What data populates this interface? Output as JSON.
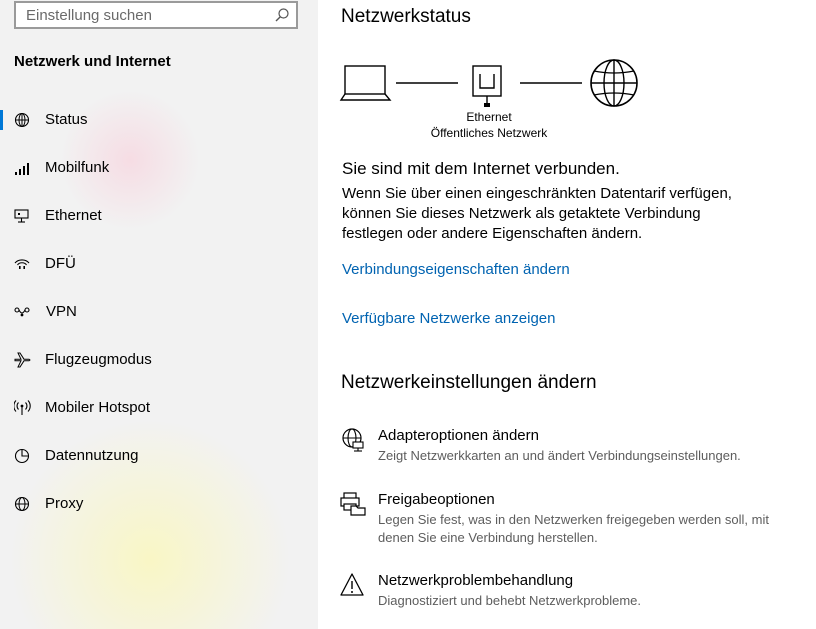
{
  "search": {
    "placeholder": "Einstellung suchen"
  },
  "sidebar": {
    "title": "Netzwerk und Internet",
    "items": [
      {
        "label": "Status",
        "icon": "globe-icon",
        "active": true
      },
      {
        "label": "Mobilfunk",
        "icon": "signal-bars-icon"
      },
      {
        "label": "Ethernet",
        "icon": "ethernet-icon"
      },
      {
        "label": "DFÜ",
        "icon": "dialup-icon"
      },
      {
        "label": "VPN",
        "icon": "vpn-icon"
      },
      {
        "label": "Flugzeugmodus",
        "icon": "airplane-icon"
      },
      {
        "label": "Mobiler Hotspot",
        "icon": "hotspot-icon"
      },
      {
        "label": "Datennutzung",
        "icon": "data-usage-icon"
      },
      {
        "label": "Proxy",
        "icon": "globe-icon"
      }
    ]
  },
  "main": {
    "title": "Netzwerkstatus",
    "diagram": {
      "adapter": "Ethernet",
      "network": "Öffentliches Netzwerk"
    },
    "connected": "Sie sind mit dem Internet verbunden.",
    "description": "Wenn Sie über einen eingeschränkten Datentarif verfügen, können Sie dieses Netzwerk als getaktete Verbindung festlegen oder andere Eigenschaften ändern.",
    "link_properties": "Verbindungseigenschaften ändern",
    "link_networks": "Verfügbare Netzwerke anzeigen",
    "section_title": "Netzwerkeinstellungen ändern",
    "options": [
      {
        "title": "Adapteroptionen ändern",
        "desc": "Zeigt Netzwerkkarten an und ändert Verbindungseinstellungen.",
        "icon": "adapter-icon"
      },
      {
        "title": "Freigabeoptionen",
        "desc": "Legen Sie fest, was in den Netzwerken freigegeben werden soll, mit denen Sie eine Verbindung herstellen.",
        "icon": "sharing-icon"
      },
      {
        "title": "Netzwerkproblembehandlung",
        "desc": "Diagnostiziert und behebt Netzwerkprobleme.",
        "icon": "warning-icon"
      }
    ]
  },
  "colors": {
    "accent": "#0078d7",
    "link": "#0063b1",
    "sidebar_bg": "#f2f2f2"
  }
}
